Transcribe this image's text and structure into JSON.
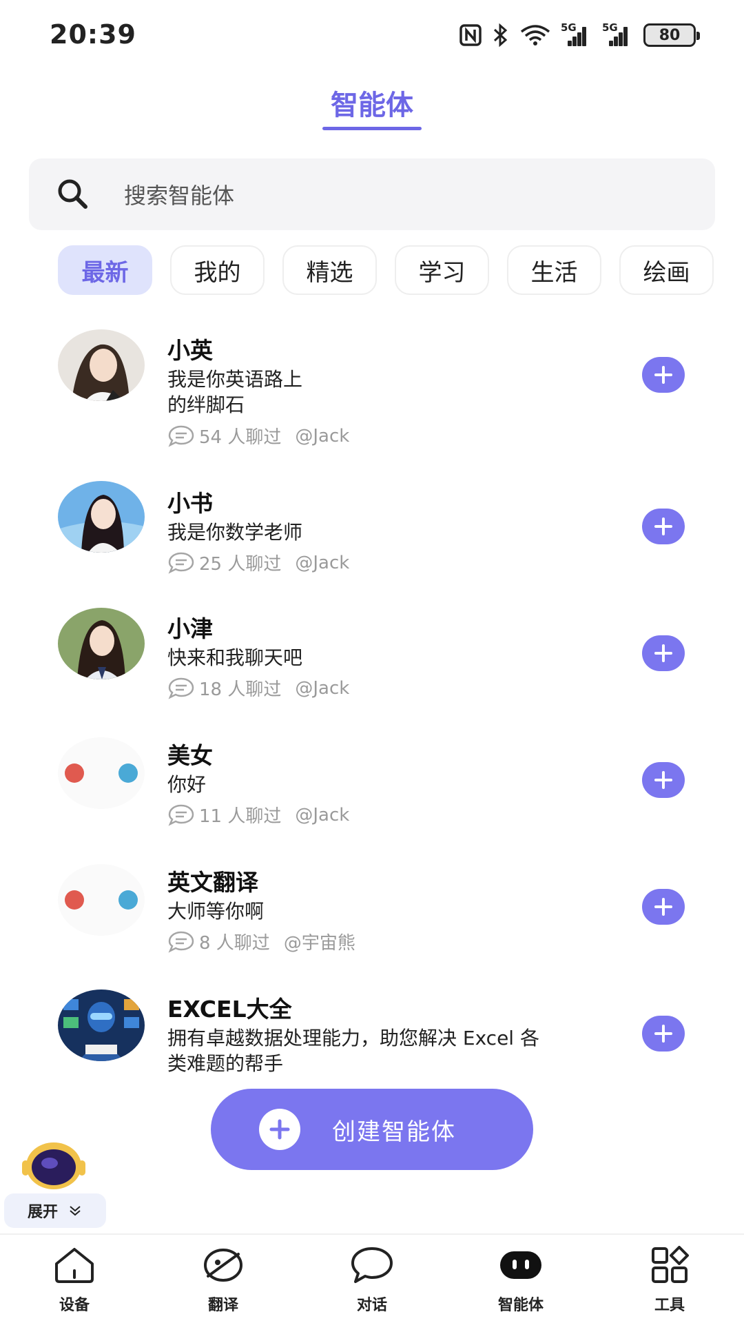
{
  "status_bar": {
    "time": "20:39",
    "battery": "80",
    "signal_label": "5G"
  },
  "header": {
    "title": "智能体"
  },
  "search": {
    "placeholder": "搜索智能体"
  },
  "tabs": [
    "最新",
    "我的",
    "精选",
    "学习",
    "生活",
    "绘画"
  ],
  "active_tab": "最新",
  "agents": [
    {
      "name": "小英",
      "desc": "我是你英语路上\n的绊脚石",
      "count": "54 人聊过",
      "author": "@Jack"
    },
    {
      "name": "小书",
      "desc": "我是你数学老师",
      "count": "25 人聊过",
      "author": "@Jack"
    },
    {
      "name": "小津",
      "desc": "快来和我聊天吧",
      "count": "18 人聊过",
      "author": "@Jack"
    },
    {
      "name": "美女",
      "desc": "你好",
      "count": "11 人聊过",
      "author": "@Jack"
    },
    {
      "name": "英文翻译",
      "desc": "大师等你啊",
      "count": "8 人聊过",
      "author": "@宇宙熊"
    },
    {
      "name": "EXCEL大全",
      "desc": "拥有卓越数据处理能力，助您解决 Excel 各\n类难题的帮手",
      "count": "",
      "author": ""
    }
  ],
  "create_button": {
    "label": "创建智能体"
  },
  "float_widget": {
    "label": "展开"
  },
  "bottom_nav": [
    {
      "label": "设备",
      "icon": "home-icon"
    },
    {
      "label": "翻译",
      "icon": "translate-icon"
    },
    {
      "label": "对话",
      "icon": "chat-bubble-icon"
    },
    {
      "label": "智能体",
      "icon": "agent-icon"
    },
    {
      "label": "工具",
      "icon": "tools-icon"
    }
  ],
  "colors": {
    "accent": "#7b76ef",
    "title": "#6d67e6",
    "chip_active_bg": "#dfe3fc"
  }
}
